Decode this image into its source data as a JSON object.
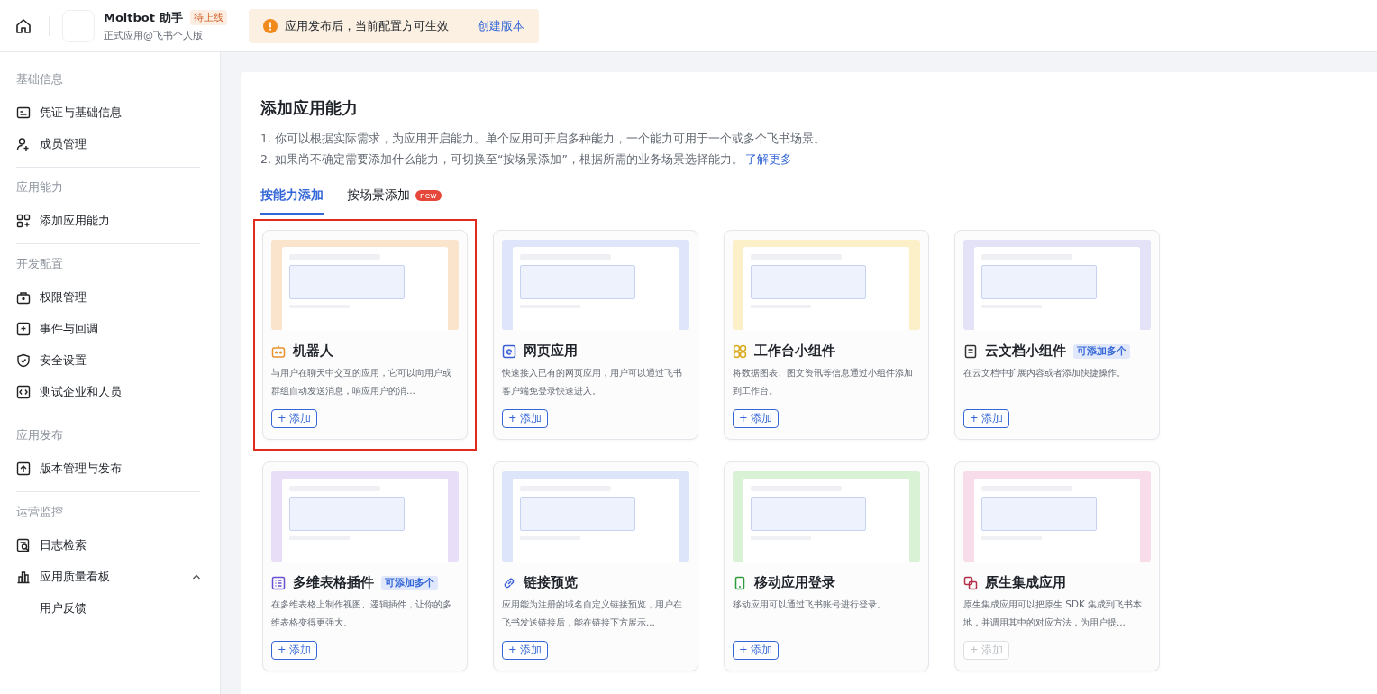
{
  "header": {
    "app_name": "Moltbot 助手",
    "status_badge": "待上线",
    "subtitle": "正式应用@飞书个人版",
    "notice": {
      "text": "应用发布后，当前配置方可生效",
      "link": "创建版本"
    }
  },
  "sidebar": {
    "groups": [
      {
        "title": "基础信息",
        "items": [
          {
            "label": "凭证与基础信息"
          },
          {
            "label": "成员管理"
          }
        ]
      },
      {
        "title": "应用能力",
        "items": [
          {
            "label": "添加应用能力"
          }
        ]
      },
      {
        "title": "开发配置",
        "items": [
          {
            "label": "权限管理"
          },
          {
            "label": "事件与回调"
          },
          {
            "label": "安全设置"
          },
          {
            "label": "测试企业和人员"
          }
        ]
      },
      {
        "title": "应用发布",
        "items": [
          {
            "label": "版本管理与发布"
          }
        ]
      },
      {
        "title": "运营监控",
        "items": [
          {
            "label": "日志检索"
          },
          {
            "label": "应用质量看板",
            "expanded": true,
            "children": [
              {
                "label": "用户反馈"
              }
            ]
          }
        ]
      }
    ]
  },
  "main": {
    "title": "添加应用能力",
    "notes": [
      "1. 你可以根据实际需求，为应用开启能力。单个应用可开启多种能力，一个能力可用于一个或多个飞书场景。",
      "2. 如果尚不确定需要添加什么能力，可切换至“按场景添加”，根据所需的业务场景选择能力。"
    ],
    "notes_link": "了解更多",
    "tabs": [
      {
        "label": "按能力添加",
        "selected": true
      },
      {
        "label": "按场景添加",
        "selected": false,
        "badge": "new"
      }
    ],
    "cards": [
      {
        "kind": "robot",
        "title": "机器人",
        "description": "与用户在聊天中交互的应用，它可以向用户或群组自动发送消息，响应用户的消...",
        "button": "+ 添加",
        "disabled": false,
        "highlighted": true,
        "color": "#fbe4cc"
      },
      {
        "kind": "web",
        "title": "网页应用",
        "description": "快速接入已有的网页应用，用户可以通过飞书客户端免登录快速进入。",
        "button": "+ 添加",
        "disabled": false,
        "highlighted": false,
        "color": "#dfe5fa"
      },
      {
        "kind": "widget",
        "title": "工作台小组件",
        "description": "将数据图表、图文资讯等信息通过小组件添加到工作台。",
        "button": "+ 添加",
        "disabled": false,
        "highlighted": false,
        "color": "#fbf0c8"
      },
      {
        "kind": "doc",
        "title": "云文档小组件",
        "tag": "可添加多个",
        "description": "在云文档中扩展内容或者添加快捷操作。",
        "button": "+ 添加",
        "disabled": false,
        "highlighted": false,
        "color": "#e3e2f7"
      },
      {
        "kind": "table",
        "title": "多维表格插件",
        "tag": "可添加多个",
        "description": "在多维表格上制作视图、逻辑插件，让你的多维表格变得更强大。",
        "button": "+ 添加",
        "disabled": false,
        "highlighted": false,
        "color": "#e9def8"
      },
      {
        "kind": "link",
        "title": "链接预览",
        "description": "应用能为注册的域名自定义链接预览，用户在飞书发送链接后，能在链接下方展示...",
        "button": "+ 添加",
        "disabled": false,
        "highlighted": false,
        "color": "#dde5fb"
      },
      {
        "kind": "mobile",
        "title": "移动应用登录",
        "description": "移动应用可以通过飞书账号进行登录。",
        "button": "+ 添加",
        "disabled": false,
        "highlighted": false,
        "color": "#d9f1d5"
      },
      {
        "kind": "native",
        "title": "原生集成应用",
        "description": "原生集成应用可以把原生 SDK 集成到飞书本地，并调用其中的对应方法，为用户提...",
        "button": "+ 添加",
        "disabled": true,
        "highlighted": false,
        "color": "#f9dce9"
      }
    ]
  }
}
